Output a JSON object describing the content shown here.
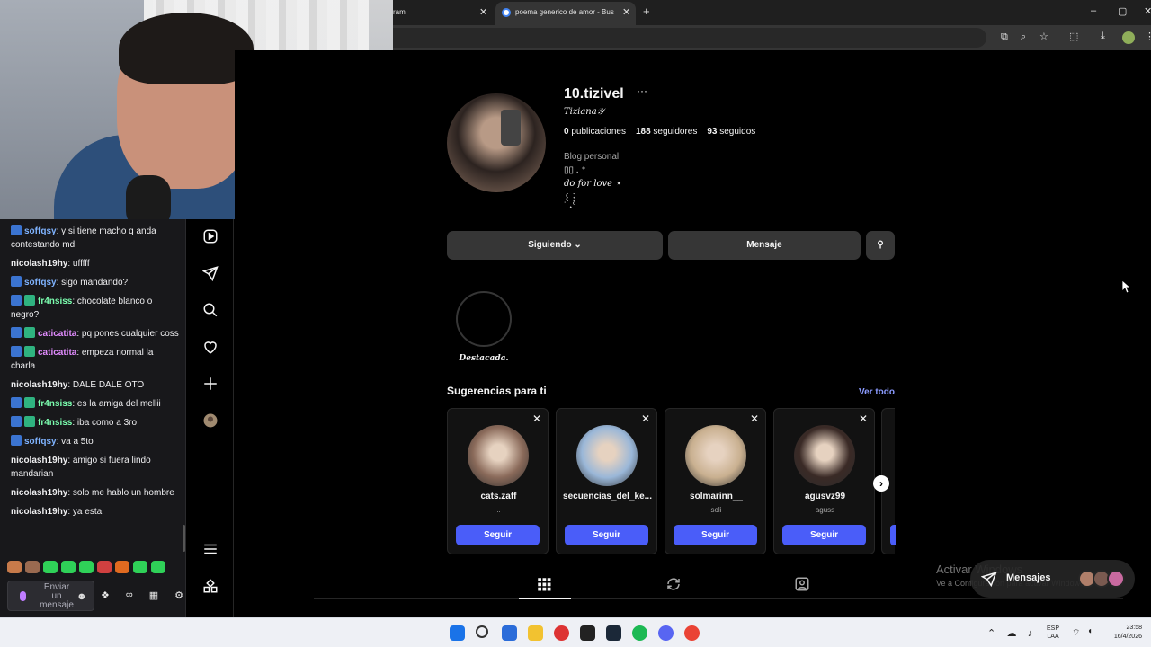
{
  "browser": {
    "tabs": [
      {
        "title": "ram",
        "active": false
      },
      {
        "title": "poema generico de amor - Bus",
        "active": true
      }
    ],
    "window_controls": [
      "minimize",
      "maximize",
      "close"
    ]
  },
  "chat": {
    "messages": [
      {
        "user": "soffqsy",
        "color": "#7fb3ff",
        "badges": [
          "b1"
        ],
        "text": "y si tiene macho q anda contestando md"
      },
      {
        "user": "nicolash19hy",
        "color": "#efeff1",
        "badges": [],
        "text": "ufffff"
      },
      {
        "user": "soffqsy",
        "color": "#7fb3ff",
        "badges": [
          "b1"
        ],
        "text": "sigo mandando?"
      },
      {
        "user": "fr4nsiss",
        "color": "#7cffb0",
        "badges": [
          "b1",
          "b2"
        ],
        "text": "chocolate blanco o negro?"
      },
      {
        "user": "caticatita",
        "color": "#e28cff",
        "badges": [
          "b1",
          "b2"
        ],
        "text": "pq pones cualquier coss"
      },
      {
        "user": "caticatita",
        "color": "#e28cff",
        "badges": [
          "b1",
          "b2"
        ],
        "text": "empeza normal la charla"
      },
      {
        "user": "nicolash19hy",
        "color": "#efeff1",
        "badges": [],
        "text": "DALE DALE OTO"
      },
      {
        "user": "fr4nsiss",
        "color": "#7cffb0",
        "badges": [
          "b1",
          "b2"
        ],
        "text": "es la amiga del mellii"
      },
      {
        "user": "fr4nsiss",
        "color": "#7cffb0",
        "badges": [
          "b1",
          "b2"
        ],
        "text": "iba como a 3ro"
      },
      {
        "user": "soffqsy",
        "color": "#7fb3ff",
        "badges": [
          "b1"
        ],
        "text": "va a 5to"
      },
      {
        "user": "nicolash19hy",
        "color": "#efeff1",
        "badges": [],
        "text": "amigo si fuera lindo mandarian"
      },
      {
        "user": "nicolash19hy",
        "color": "#efeff1",
        "badges": [],
        "text": "solo me hablo un hombre"
      },
      {
        "user": "nicolash19hy",
        "color": "#efeff1",
        "badges": [],
        "text": "ya esta"
      }
    ],
    "input_placeholder": "Enviar un mensaje",
    "emote_colors": [
      "#c77a4a",
      "#9a6a50",
      "#2fd158",
      "#2fd158",
      "#2fd158",
      "#d04040",
      "#e06a20",
      "#2fd158",
      "#2fd158"
    ]
  },
  "profile": {
    "username": "10.tizivel",
    "more_label": "···",
    "full_name": "Tiziana𝒴",
    "stats": [
      {
        "count": "0",
        "label": "publicaciones"
      },
      {
        "count": "188",
        "label": "seguidores"
      },
      {
        "count": "93",
        "label": "seguidos"
      }
    ],
    "category": "Blog personal",
    "bio_lines": [
      "▯▯ . ⁺",
      "do for love ⋆",
      "꒰꒱",
      "˙ ˖°"
    ],
    "following_label": "Siguiendo",
    "message_label": "Mensaje",
    "highlight_label": "Destacada."
  },
  "suggestions": {
    "title": "Sugerencias para ti",
    "see_all": "Ver todo",
    "follow_label": "Seguir",
    "cards": [
      {
        "name": "cats.zaff",
        "sub": "..",
        "color": "#8a6a5a"
      },
      {
        "name": "secuencias_del_ke...",
        "sub": "",
        "color": "#9ab7d8"
      },
      {
        "name": "solmarinn__",
        "sub": "soli",
        "color": "#c9b090"
      },
      {
        "name": "agusvz99",
        "sub": "aguss",
        "color": "#3a2a26"
      }
    ]
  },
  "overlay": {
    "watermark_title": "Activar Windows",
    "watermark_sub": "Ve a Configuración para activar Windows.",
    "messages_pill": "Mensajes"
  },
  "taskbar": {
    "apps": [
      "windows-start",
      "search",
      "store",
      "file-explorer",
      "app-red",
      "epic-games",
      "steam",
      "spotify",
      "discord",
      "chrome"
    ],
    "lang_top": "ESP",
    "lang_bottom": "LAA",
    "time": "23:58",
    "date": "16/4/2026"
  }
}
